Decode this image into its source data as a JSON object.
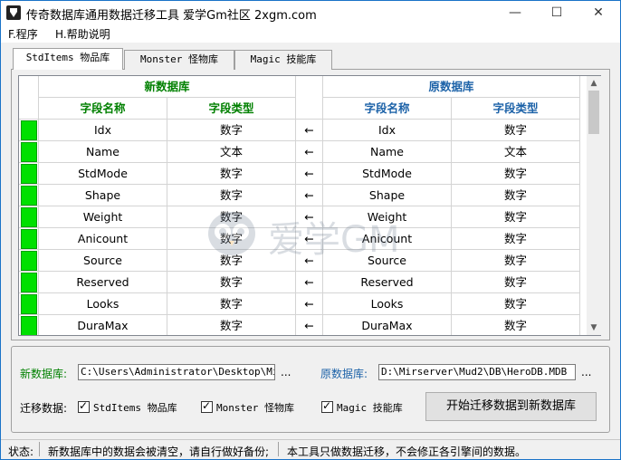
{
  "window": {
    "title": "传奇数据库通用数据迁移工具  爱学Gm社区 2xgm.com",
    "minimize": "—",
    "maximize": "☐",
    "close": "✕"
  },
  "menu": [
    "F.程序",
    "H.帮助说明"
  ],
  "tabs": [
    "StdItems 物品库",
    "Monster 怪物库",
    "Magic 技能库"
  ],
  "grid": {
    "new_db_header": "新数据库",
    "old_db_header": "原数据库",
    "col_field_name": "字段名称",
    "col_field_type": "字段类型",
    "arrow": "←",
    "rows": [
      {
        "new_name": "Idx",
        "new_type": "数字",
        "old_name": "Idx",
        "old_type": "数字"
      },
      {
        "new_name": "Name",
        "new_type": "文本",
        "old_name": "Name",
        "old_type": "文本"
      },
      {
        "new_name": "StdMode",
        "new_type": "数字",
        "old_name": "StdMode",
        "old_type": "数字"
      },
      {
        "new_name": "Shape",
        "new_type": "数字",
        "old_name": "Shape",
        "old_type": "数字"
      },
      {
        "new_name": "Weight",
        "new_type": "数字",
        "old_name": "Weight",
        "old_type": "数字"
      },
      {
        "new_name": "Anicount",
        "new_type": "数字",
        "old_name": "Anicount",
        "old_type": "数字"
      },
      {
        "new_name": "Source",
        "new_type": "数字",
        "old_name": "Source",
        "old_type": "数字"
      },
      {
        "new_name": "Reserved",
        "new_type": "数字",
        "old_name": "Reserved",
        "old_type": "数字"
      },
      {
        "new_name": "Looks",
        "new_type": "数字",
        "old_name": "Looks",
        "old_type": "数字"
      },
      {
        "new_name": "DuraMax",
        "new_type": "数字",
        "old_name": "DuraMax",
        "old_type": "数字"
      }
    ]
  },
  "watermark": "爱学GM",
  "bottom": {
    "new_db_label": "新数据库:",
    "new_db_path": "C:\\Users\\Administrator\\Desktop\\MirSe",
    "old_db_label": "原数据库:",
    "old_db_path": "D:\\Mirserver\\Mud2\\DB\\HeroDB.MDB",
    "browse": "...",
    "migrate_label": "迁移数据:",
    "chk_stditems": "StdItems 物品库",
    "chk_monster": "Monster 怪物库",
    "chk_magic": "Magic 技能库",
    "start_button": "开始迁移数据到新数据库"
  },
  "status": {
    "label": "状态:",
    "message1": "新数据库中的数据会被清空，请自行做好备份;",
    "message2": "本工具只做数据迁移，不会修正各引擎间的数据。"
  },
  "colors": {
    "accent": "#1a73c8",
    "green_text": "#008000",
    "blue_text": "#1c62a8",
    "row_marker": "#00e000"
  }
}
